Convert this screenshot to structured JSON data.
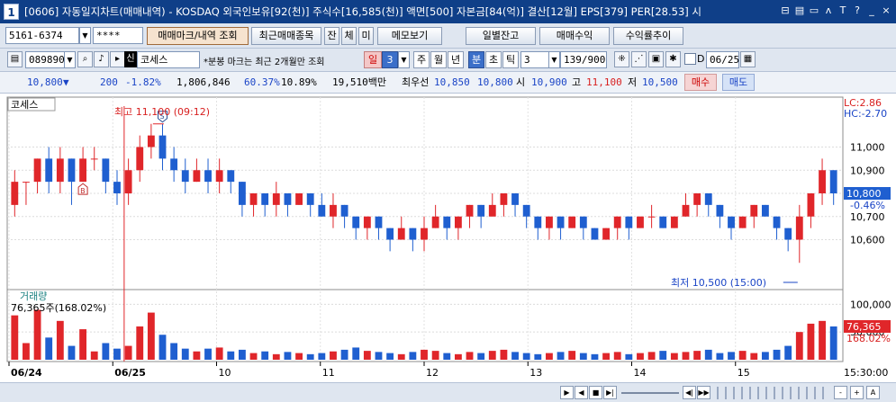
{
  "window": {
    "num": "1",
    "title": "[0606] 자동일지차트(매매내역) - KOSDAQ 외국인보유[92(천)] 주식수[16,585(천)] 액면[500] 자본금[84(억)] 결산[12월] EPS[379] PER[28.53] 시",
    "controls": [
      "⊟",
      "▤",
      "▭",
      "ʌ",
      "T",
      "?",
      "_",
      "×"
    ]
  },
  "toolbar1": {
    "account": "5161-6374",
    "password": "****",
    "buttons": {
      "mark": "매매마크/내역 조회",
      "recent": "최근매매종목",
      "jan": "잔",
      "che": "체",
      "mi": "미",
      "memo": "메모보기",
      "daily_balance": "일별잔고",
      "profit": "매매수익",
      "yield": "수익률추이"
    }
  },
  "toolbar2": {
    "code": "089890",
    "name_badge": "신",
    "stock_name": "코세스",
    "note": "*분봉 마크는 최근 2개월만 조회",
    "period": {
      "il": "일",
      "val": "3",
      "ju": "주",
      "wol": "월",
      "nyeon": "년",
      "bun": "분",
      "cho": "초",
      "tik": "틱"
    },
    "tick_value": "3",
    "count": "139/900",
    "date_label": "D",
    "date": "06/25"
  },
  "quote": {
    "price": "10,800",
    "arrow": "▼",
    "change": "200",
    "change_pct": "-1.82%",
    "volume": "1,806,846",
    "vol_ratio": "60.37%",
    "turnover": "10.89%",
    "amount": "19,510백만",
    "best_label": "최우선",
    "ask": "10,850",
    "bid": "10,800",
    "open_label": "시",
    "open": "10,900",
    "high_label": "고",
    "high": "11,100",
    "low_label": "저",
    "low": "10,500",
    "buy": "매수",
    "sell": "매도"
  },
  "chart_data": {
    "type": "candlestick",
    "stock": "코세스",
    "lc_label": "LC:2.86",
    "hc_label": "HC:-2.70",
    "price_axis": {
      "ticks": [
        11000,
        10900,
        10800,
        10700,
        10600
      ],
      "labels": [
        "11,000",
        "10,900",
        "10,800",
        "10,700",
        "10,600"
      ],
      "range": [
        10400,
        11200
      ]
    },
    "current_price": "10,800",
    "current_pct": "-0.46%",
    "high_annotation": "최고 11,100 (09:12)",
    "low_annotation": "최저 10,500 (15:00)",
    "volume_title": "거래량",
    "volume_label": "76,365주(168.02%)",
    "volume_axis": {
      "ticks": [
        100000,
        50000
      ],
      "labels": [
        "100,000",
        "50,000"
      ],
      "range": [
        0,
        120000
      ]
    },
    "current_volume": "76,365",
    "current_volume_pct": "168.02%",
    "x_labels": [
      "06/24",
      "06/25",
      "10",
      "11",
      "12",
      "13",
      "14",
      "15"
    ],
    "time_label": "15:30:00",
    "marks": [
      {
        "type": "B",
        "label": "B"
      },
      {
        "type": "S",
        "label": "S"
      }
    ],
    "candles": [
      [
        10750,
        10850,
        10700,
        10900
      ],
      [
        10850,
        10850,
        10750,
        10850
      ],
      [
        10850,
        10950,
        10800,
        10950
      ],
      [
        10950,
        10850,
        10800,
        11000
      ],
      [
        10850,
        10950,
        10800,
        11000
      ],
      [
        10950,
        10850,
        10750,
        10950
      ],
      [
        10850,
        10950,
        10850,
        11000
      ],
      [
        10950,
        10950,
        10900,
        11000
      ],
      [
        10950,
        10850,
        10800,
        10950
      ],
      [
        10850,
        10800,
        10750,
        10900
      ],
      [
        10800,
        10900,
        10750,
        10950
      ],
      [
        10900,
        11000,
        10850,
        11050
      ],
      [
        11000,
        11050,
        10950,
        11100
      ],
      [
        11050,
        10950,
        10900,
        11100
      ],
      [
        10950,
        10900,
        10850,
        11000
      ],
      [
        10900,
        10850,
        10800,
        10950
      ],
      [
        10850,
        10900,
        10850,
        10950
      ],
      [
        10900,
        10850,
        10800,
        10950
      ],
      [
        10850,
        10900,
        10800,
        10950
      ],
      [
        10900,
        10850,
        10800,
        10900
      ],
      [
        10850,
        10750,
        10700,
        10850
      ],
      [
        10750,
        10800,
        10700,
        10800
      ],
      [
        10800,
        10750,
        10700,
        10800
      ],
      [
        10750,
        10800,
        10700,
        10850
      ],
      [
        10800,
        10750,
        10700,
        10800
      ],
      [
        10750,
        10800,
        10750,
        10800
      ],
      [
        10800,
        10750,
        10700,
        10800
      ],
      [
        10750,
        10700,
        10700,
        10800
      ],
      [
        10700,
        10750,
        10650,
        10800
      ],
      [
        10750,
        10700,
        10650,
        10750
      ],
      [
        10700,
        10650,
        10600,
        10700
      ],
      [
        10650,
        10700,
        10600,
        10700
      ],
      [
        10700,
        10650,
        10600,
        10700
      ],
      [
        10650,
        10600,
        10550,
        10650
      ],
      [
        10600,
        10650,
        10600,
        10700
      ],
      [
        10650,
        10600,
        10550,
        10650
      ],
      [
        10600,
        10650,
        10550,
        10700
      ],
      [
        10650,
        10700,
        10650,
        10750
      ],
      [
        10700,
        10650,
        10600,
        10700
      ],
      [
        10650,
        10700,
        10600,
        10700
      ],
      [
        10700,
        10750,
        10650,
        10750
      ],
      [
        10750,
        10700,
        10650,
        10750
      ],
      [
        10700,
        10750,
        10700,
        10800
      ],
      [
        10750,
        10800,
        10700,
        10800
      ],
      [
        10800,
        10750,
        10700,
        10800
      ],
      [
        10750,
        10700,
        10650,
        10750
      ],
      [
        10700,
        10650,
        10600,
        10700
      ],
      [
        10650,
        10700,
        10600,
        10700
      ],
      [
        10700,
        10650,
        10600,
        10700
      ],
      [
        10650,
        10700,
        10650,
        10700
      ],
      [
        10700,
        10650,
        10600,
        10700
      ],
      [
        10650,
        10600,
        10600,
        10650
      ],
      [
        10600,
        10650,
        10600,
        10650
      ],
      [
        10650,
        10700,
        10600,
        10700
      ],
      [
        10700,
        10650,
        10600,
        10700
      ],
      [
        10650,
        10700,
        10650,
        10700
      ],
      [
        10700,
        10700,
        10650,
        10750
      ],
      [
        10700,
        10650,
        10650,
        10700
      ],
      [
        10650,
        10700,
        10650,
        10700
      ],
      [
        10700,
        10750,
        10700,
        10800
      ],
      [
        10750,
        10800,
        10700,
        10800
      ],
      [
        10800,
        10750,
        10700,
        10800
      ],
      [
        10750,
        10700,
        10650,
        10750
      ],
      [
        10700,
        10650,
        10600,
        10700
      ],
      [
        10650,
        10700,
        10650,
        10700
      ],
      [
        10700,
        10750,
        10650,
        10750
      ],
      [
        10750,
        10700,
        10700,
        10750
      ],
      [
        10700,
        10650,
        10600,
        10700
      ],
      [
        10650,
        10600,
        10550,
        10650
      ],
      [
        10600,
        10700,
        10500,
        10750
      ],
      [
        10700,
        10800,
        10650,
        10800
      ],
      [
        10800,
        10900,
        10750,
        10950
      ],
      [
        10900,
        10800,
        10750,
        10900
      ]
    ],
    "volumes": [
      80,
      30,
      90,
      40,
      70,
      25,
      55,
      15,
      30,
      20,
      25,
      60,
      85,
      45,
      30,
      20,
      15,
      20,
      22,
      15,
      18,
      12,
      15,
      10,
      14,
      12,
      10,
      12,
      15,
      18,
      22,
      16,
      14,
      12,
      10,
      14,
      18,
      16,
      12,
      10,
      14,
      12,
      16,
      18,
      14,
      12,
      10,
      12,
      14,
      16,
      12,
      10,
      12,
      14,
      10,
      12,
      14,
      16,
      12,
      14,
      16,
      18,
      12,
      14,
      16,
      12,
      14,
      18,
      25,
      50,
      65,
      70,
      60
    ]
  },
  "bottom": {
    "nav": [
      "▶",
      "◀",
      "■",
      "▶|",
      "◀|",
      "▶▶"
    ],
    "zoom": [
      "-",
      "+",
      "A"
    ]
  }
}
